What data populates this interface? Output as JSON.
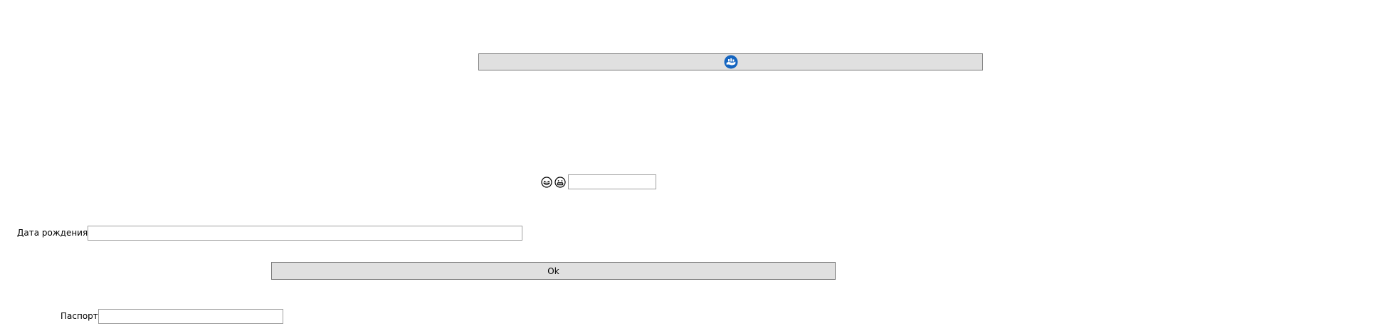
{
  "top_button": {
    "icon": "blue-circle-badge-icon",
    "icon_color": "#1565c0"
  },
  "emoji_row": {
    "emoji_1": "laughing-face-icon",
    "emoji_2": "grinning-face-icon",
    "input_value": ""
  },
  "dob": {
    "label": "Дата рождения",
    "value": ""
  },
  "ok_button": {
    "label": "Ok"
  },
  "passport": {
    "label": "Паспорт",
    "value": ""
  },
  "colors": {
    "button_bg": "#e0e0e0",
    "button_border": "#7a7a7a",
    "input_border": "#a0a0a0"
  }
}
